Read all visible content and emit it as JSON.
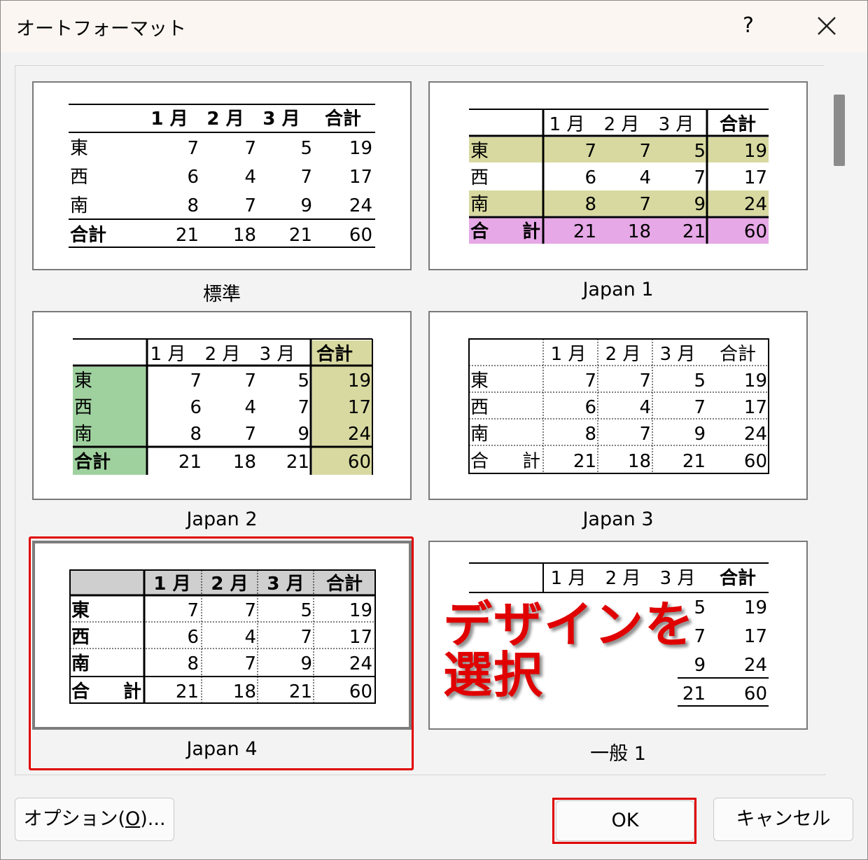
{
  "window": {
    "title": "オートフォーマット",
    "help": "?",
    "close_icon": "close-icon"
  },
  "grid": {
    "months": [
      "1 月",
      "2 月",
      "3 月"
    ],
    "total_header": "合計",
    "rows": [
      {
        "label": "東",
        "values": [
          "7",
          "7",
          "5",
          "19"
        ]
      },
      {
        "label": "西",
        "values": [
          "6",
          "4",
          "7",
          "17"
        ]
      },
      {
        "label": "南",
        "values": [
          "8",
          "7",
          "9",
          "24"
        ]
      }
    ],
    "total_row": {
      "label": "合計",
      "label_spaced": "合　　計",
      "values": [
        "21",
        "18",
        "21",
        "60"
      ]
    }
  },
  "formats": [
    {
      "name": "標準"
    },
    {
      "name": "Japan 1"
    },
    {
      "name": "Japan 2"
    },
    {
      "name": "Japan 3"
    },
    {
      "name": "Japan 4",
      "selected": true
    },
    {
      "name": "一般 1"
    }
  ],
  "annotation": {
    "line1": "デザインを",
    "line2": "選択"
  },
  "buttons": {
    "options_pre": "オプション(",
    "options_key": "O",
    "options_post": ")...",
    "ok": "OK",
    "cancel": "キャンセル"
  },
  "colors": {
    "accent_red": "#e00000",
    "olive": "#d8d9a0",
    "pink": "#e6a8e6",
    "green": "#9fd19f"
  }
}
